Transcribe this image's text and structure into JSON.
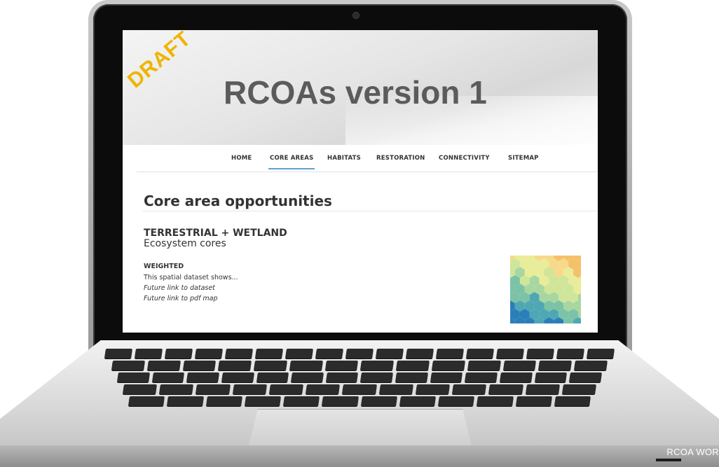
{
  "screen": {
    "draft_label": "DRAFT",
    "hero_title": "RCOAs version 1",
    "nav": [
      {
        "label": "HOME",
        "active": false
      },
      {
        "label": "CORE AREAS",
        "active": true
      },
      {
        "label": "HABITATS",
        "active": false
      },
      {
        "label": "RESTORATION",
        "active": false
      },
      {
        "label": "CONNECTIVITY",
        "active": false
      },
      {
        "label": "SITEMAP",
        "active": false
      }
    ],
    "page_heading": "Core area opportunities",
    "section_title": "TERRESTRIAL + WETLAND",
    "section_subtitle": "Ecosystem cores",
    "weighted": {
      "label": "WEIGHTED",
      "description": "This spatial dataset shows...",
      "link_dataset": "Future link to dataset",
      "link_pdf": "Future link to pdf map"
    },
    "thumbnail_icon": "hexbin-map-thumbnail"
  },
  "footer_label": "RCOA WOR",
  "colors": {
    "draft": "#f0b400",
    "title": "#5b5b5b",
    "nav_active_underline": "#5da3c8",
    "laptop_bezel": "#0c0c0c"
  }
}
